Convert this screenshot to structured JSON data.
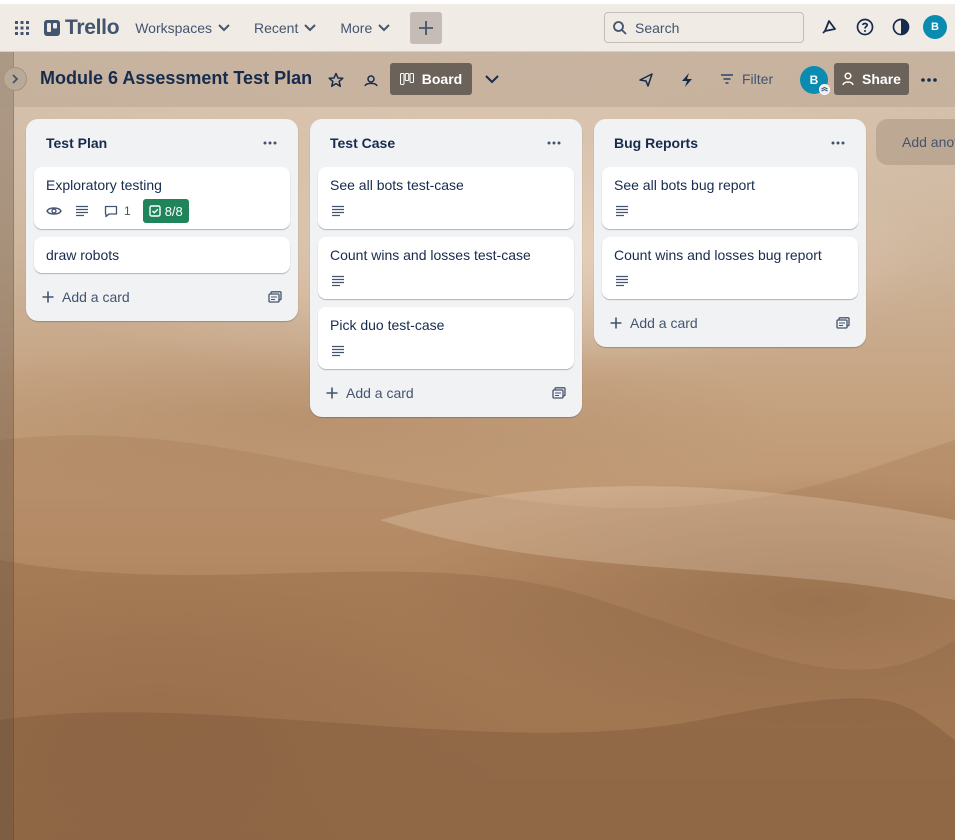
{
  "header": {
    "app_name": "Trello",
    "nav": [
      "Workspaces",
      "Recent",
      "More"
    ],
    "search_placeholder": "Search",
    "user_initial": "B"
  },
  "board": {
    "title": "Module 6 Assessment Test Plan",
    "view_label": "Board",
    "filter_label": "Filter",
    "share_label": "Share",
    "member_initial": "B"
  },
  "lists": [
    {
      "title": "Test Plan",
      "add_card_label": "Add a card",
      "cards": [
        {
          "title": "Exploratory testing",
          "comments": "1",
          "checklist": "8/8"
        },
        {
          "title": "draw robots"
        }
      ]
    },
    {
      "title": "Test Case",
      "add_card_label": "Add a card",
      "cards": [
        {
          "title": "See all bots test-case"
        },
        {
          "title": "Count wins and losses test-case"
        },
        {
          "title": "Pick duo test-case"
        }
      ]
    },
    {
      "title": "Bug Reports",
      "add_card_label": "Add a card",
      "cards": [
        {
          "title": "See all bots bug report"
        },
        {
          "title": "Count wins and losses bug report"
        }
      ]
    }
  ],
  "add_list_label": "Add another list",
  "colors": {
    "checklist_complete": "#1f845a",
    "avatar": "#0a8bb0",
    "view_button": "#6b625a"
  }
}
